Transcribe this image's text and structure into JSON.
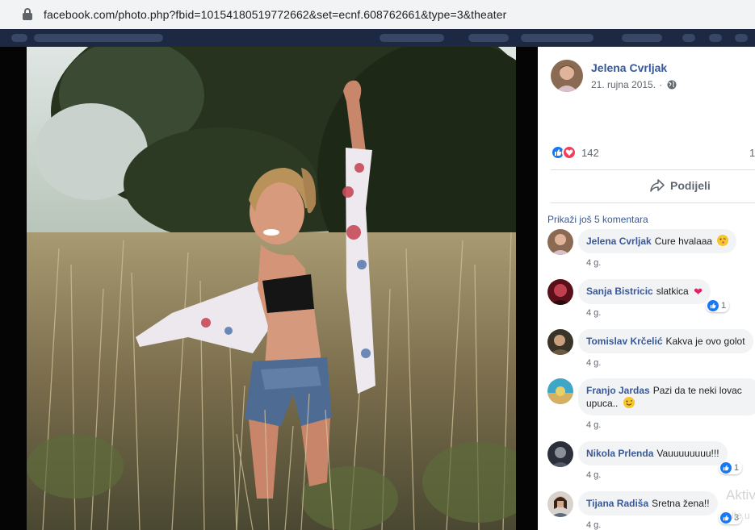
{
  "browser": {
    "url": "facebook.com/photo.php?fbid=10154180519772662&set=ecnf.608762661&type=3&theater"
  },
  "post": {
    "author": "Jelena Cvrljak",
    "date": "21. rujna 2015.",
    "separator": "·",
    "reaction_count": "142",
    "reaction_count_2": "1",
    "share_label": "Podijeli",
    "more_comments": "Prikaži još 5 komentara"
  },
  "comments": [
    {
      "name": "Jelena Cvrljak",
      "text": "Cure hvalaaa",
      "time": "4 g.",
      "emoji": "kiss-emoji"
    },
    {
      "name": "Sanja Bistricic",
      "text": "slatkica",
      "time": "4 g.",
      "emoji": "heart",
      "likes": "1"
    },
    {
      "name": "Tomislav Krčelić",
      "text": "Kakva je ovo golot",
      "time": "4 g."
    },
    {
      "name": "Franjo Jardas",
      "text": "Pazi da te neki lovac",
      "text2": "upuca..",
      "time": "4 g.",
      "emoji": "smile-emoji"
    },
    {
      "name": "Nikola Prlenda",
      "text": "Vauuuuuuuu!!!",
      "time": "4 g.",
      "likes": "1"
    },
    {
      "name": "Tijana Radiša",
      "text": "Sretna žena!!",
      "time": "4 g.",
      "likes": "3"
    }
  ],
  "watermark": {
    "line1": "Aktiv",
    "line2": "ite u"
  },
  "colors": {
    "link": "#385898",
    "like": "#1877f2",
    "love": "#f33e58",
    "bubble": "#f2f3f5"
  }
}
